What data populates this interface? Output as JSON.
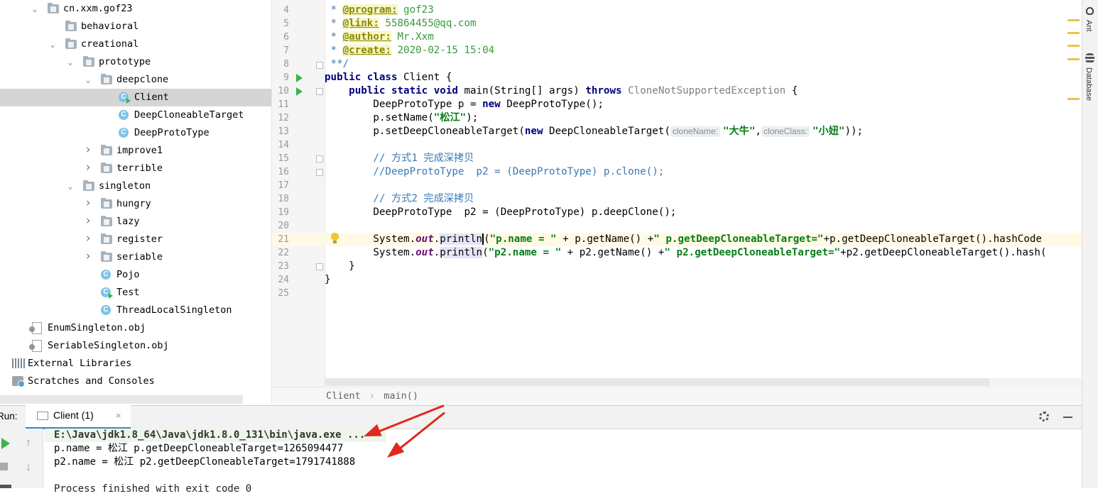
{
  "tree": [
    {
      "label": "cn.xxm.gof23",
      "level": 2,
      "expanded": true,
      "type": "package"
    },
    {
      "label": "behavioral",
      "level": 3,
      "type": "package"
    },
    {
      "label": "creational",
      "level": 3,
      "expanded": true,
      "type": "package"
    },
    {
      "label": "prototype",
      "level": 4,
      "expanded": true,
      "type": "package"
    },
    {
      "label": "deepclone",
      "level": 5,
      "expanded": true,
      "type": "package"
    },
    {
      "label": "Client",
      "level": 6,
      "type": "class-run",
      "selected": true
    },
    {
      "label": "DeepCloneableTarget",
      "level": 6,
      "type": "class"
    },
    {
      "label": "DeepProtoType",
      "level": 6,
      "type": "class"
    },
    {
      "label": "improve1",
      "level": 5,
      "collapsed": true,
      "type": "package"
    },
    {
      "label": "terrible",
      "level": 5,
      "collapsed": true,
      "type": "package"
    },
    {
      "label": "singleton",
      "level": 4,
      "expanded": true,
      "type": "package"
    },
    {
      "label": "hungry",
      "level": 5,
      "collapsed": true,
      "type": "package"
    },
    {
      "label": "lazy",
      "level": 5,
      "collapsed": true,
      "type": "package"
    },
    {
      "label": "register",
      "level": 5,
      "collapsed": true,
      "type": "package"
    },
    {
      "label": "seriable",
      "level": 5,
      "collapsed": true,
      "type": "package"
    },
    {
      "label": "Pojo",
      "level": 5,
      "type": "class"
    },
    {
      "label": "Test",
      "level": 5,
      "type": "class-run"
    },
    {
      "label": "ThreadLocalSingleton",
      "level": 5,
      "type": "class"
    },
    {
      "label": "EnumSingleton.obj",
      "level": 1,
      "type": "file"
    },
    {
      "label": "SeriableSingleton.obj",
      "level": 1,
      "type": "file"
    },
    {
      "label": "External Libraries",
      "level": 0,
      "type": "lib"
    },
    {
      "label": "Scratches and Consoles",
      "level": 0,
      "type": "scratch"
    }
  ],
  "editor": {
    "line_numbers": [
      "4",
      "5",
      "6",
      "7",
      "8",
      "9",
      "10",
      "11",
      "12",
      "13",
      "14",
      "15",
      "16",
      "17",
      "18",
      "19",
      "20",
      "21",
      "22",
      "23",
      "24",
      "25"
    ],
    "lines": [
      {
        "t": "comment",
        "s": [
          {
            "c": "cm",
            "v": " * "
          },
          {
            "c": "tag",
            "v": "@program:"
          },
          {
            "c": "val",
            "v": " gof23"
          }
        ]
      },
      {
        "t": "comment",
        "s": [
          {
            "c": "cm",
            "v": " * "
          },
          {
            "c": "tag",
            "v": "@link:"
          },
          {
            "c": "val",
            "v": " 55864455@qq.com"
          }
        ]
      },
      {
        "t": "comment",
        "s": [
          {
            "c": "cm",
            "v": " * "
          },
          {
            "c": "tag",
            "v": "@author:"
          },
          {
            "c": "val",
            "v": " Mr.Xxm"
          }
        ]
      },
      {
        "t": "comment",
        "s": [
          {
            "c": "cm",
            "v": " * "
          },
          {
            "c": "tag",
            "v": "@create:"
          },
          {
            "c": "val",
            "v": " 2020-02-15 15:04"
          }
        ]
      },
      {
        "t": "comment",
        "s": [
          {
            "c": "cm",
            "v": " **/"
          }
        ]
      },
      {
        "s": [
          {
            "c": "kw",
            "v": "public class "
          },
          {
            "c": "",
            "v": "Client {"
          }
        ]
      },
      {
        "s": [
          {
            "c": "",
            "v": "    "
          },
          {
            "c": "kw",
            "v": "public static void "
          },
          {
            "c": "",
            "v": "main(String[] args) "
          },
          {
            "c": "kw",
            "v": "throws "
          },
          {
            "c": "gray",
            "v": "CloneNotSupportedException"
          },
          {
            "c": "",
            "v": " {"
          }
        ]
      },
      {
        "s": [
          {
            "c": "",
            "v": "        DeepProtoType p = "
          },
          {
            "c": "kw",
            "v": "new "
          },
          {
            "c": "",
            "v": "DeepProtoType();"
          }
        ]
      },
      {
        "s": [
          {
            "c": "",
            "v": "        p.setName("
          },
          {
            "c": "str",
            "v": "\"松江\""
          },
          {
            "c": "",
            "v": ");"
          }
        ]
      },
      {
        "s": [
          {
            "c": "",
            "v": "        p.setDeepCloneableTarget("
          },
          {
            "c": "kw",
            "v": "new "
          },
          {
            "c": "",
            "v": "DeepCloneableTarget("
          },
          {
            "c": "hint",
            "v": "cloneName:"
          },
          {
            "c": "str",
            "v": "\"大牛\""
          },
          {
            "c": "",
            "v": ","
          },
          {
            "c": "hint",
            "v": "cloneClass:"
          },
          {
            "c": "str",
            "v": "\"小妞\""
          },
          {
            "c": "",
            "v": "));"
          }
        ]
      },
      {
        "s": [
          {
            "c": "",
            "v": ""
          }
        ]
      },
      {
        "s": [
          {
            "c": "",
            "v": "        "
          },
          {
            "c": "cm",
            "v": "// 方式1 完成深拷贝"
          }
        ]
      },
      {
        "s": [
          {
            "c": "",
            "v": "        "
          },
          {
            "c": "cm",
            "v": "//DeepProtoType  p2 = (DeepProtoType) p.clone();"
          }
        ]
      },
      {
        "s": [
          {
            "c": "",
            "v": ""
          }
        ]
      },
      {
        "s": [
          {
            "c": "",
            "v": "        "
          },
          {
            "c": "cm",
            "v": "// 方式2 完成深拷贝"
          }
        ]
      },
      {
        "s": [
          {
            "c": "",
            "v": "        DeepProtoType  p2 = (DeepProtoType) p.deepClone();"
          }
        ]
      },
      {
        "s": [
          {
            "c": "",
            "v": ""
          }
        ]
      },
      {
        "s": [
          {
            "c": "",
            "v": "        System."
          },
          {
            "c": "it",
            "v": "out"
          },
          {
            "c": "",
            "v": "."
          },
          {
            "c": "hl",
            "v": "println"
          },
          {
            "c": "caret",
            "v": ""
          },
          {
            "c": "",
            "v": "("
          },
          {
            "c": "str",
            "v": "\"p.name = \""
          },
          {
            "c": "",
            "v": " + p.getName() +"
          },
          {
            "c": "str",
            "v": "\" p.getDeepCloneableTarget=\""
          },
          {
            "c": "",
            "v": "+p.getDeepCloneableTarget().hashCode"
          }
        ]
      },
      {
        "s": [
          {
            "c": "",
            "v": "        System."
          },
          {
            "c": "it",
            "v": "out"
          },
          {
            "c": "",
            "v": "."
          },
          {
            "c": "hl",
            "v": "println"
          },
          {
            "c": "",
            "v": "("
          },
          {
            "c": "str",
            "v": "\"p2.name = \""
          },
          {
            "c": "",
            "v": " + p2.getName() +"
          },
          {
            "c": "str",
            "v": "\" p2.getDeepCloneableTarget=\""
          },
          {
            "c": "",
            "v": "+p2.getDeepCloneableTarget().hash("
          }
        ]
      },
      {
        "s": [
          {
            "c": "",
            "v": "    }"
          }
        ]
      },
      {
        "s": [
          {
            "c": "",
            "v": "}"
          }
        ]
      },
      {
        "s": [
          {
            "c": "",
            "v": ""
          }
        ]
      }
    ]
  },
  "breadcrumb": {
    "class": "Client",
    "sep": "›",
    "method": "main()"
  },
  "right_sidebar": {
    "ant": "Ant",
    "database": "Database"
  },
  "run": {
    "label": "Run:",
    "tab": "Client (1)",
    "close": "×",
    "output": [
      "E:\\Java\\jdk1.8_64\\Java\\jdk1.8.0_131\\bin\\java.exe ...",
      "p.name = 松江 p.getDeepCloneableTarget=1265094477",
      "p2.name = 松江 p2.getDeepCloneableTarget=1791741888",
      "",
      "Process finished with exit code 0"
    ]
  },
  "colors": {
    "accent": "#4083c9",
    "annotation_arrow": "#e0281c",
    "run_green": "#3bb54a"
  }
}
